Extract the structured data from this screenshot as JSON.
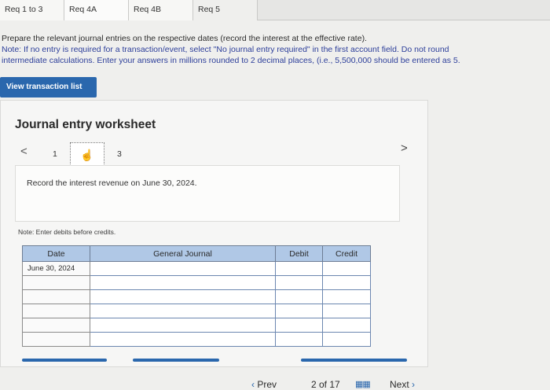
{
  "tabs": [
    {
      "label": "Req 1 to 3"
    },
    {
      "label": "Req 4A"
    },
    {
      "label": "Req 4B"
    },
    {
      "label": "Req 5"
    }
  ],
  "instructions": {
    "line1": "Prepare the relevant journal entries on the respective dates (record the interest at the effective rate).",
    "line2": "Note: If no entry is required for a transaction/event, select \"No journal entry required\" in the first account field. Do not round",
    "line3": "intermediate calculations. Enter your answers in millions rounded to 2 decimal places, (i.e., 5,500,000 should be entered as 5."
  },
  "view_transaction_button": "View transaction list",
  "worksheet": {
    "title": "Journal entry worksheet",
    "pager": {
      "prev": "<",
      "page1": "1",
      "page3": "3",
      "next": ">",
      "current_icon": "hand-pointer-icon"
    },
    "prompt": "Record the interest revenue on June 30, 2024.",
    "note": "Note: Enter debits before credits."
  },
  "journal_table": {
    "headers": [
      "Date",
      "General Journal",
      "Debit",
      "Credit"
    ],
    "rows": [
      {
        "date": "June 30, 2024"
      },
      {
        "date": ""
      },
      {
        "date": ""
      },
      {
        "date": ""
      },
      {
        "date": ""
      },
      {
        "date": ""
      }
    ]
  },
  "bottom_nav": {
    "prev": "Prev",
    "page": "2 of 17",
    "next": "Next",
    "grid_icon": "grid-icon"
  },
  "colors": {
    "accent": "#2a67ad",
    "table_header": "#b0c8e6"
  }
}
